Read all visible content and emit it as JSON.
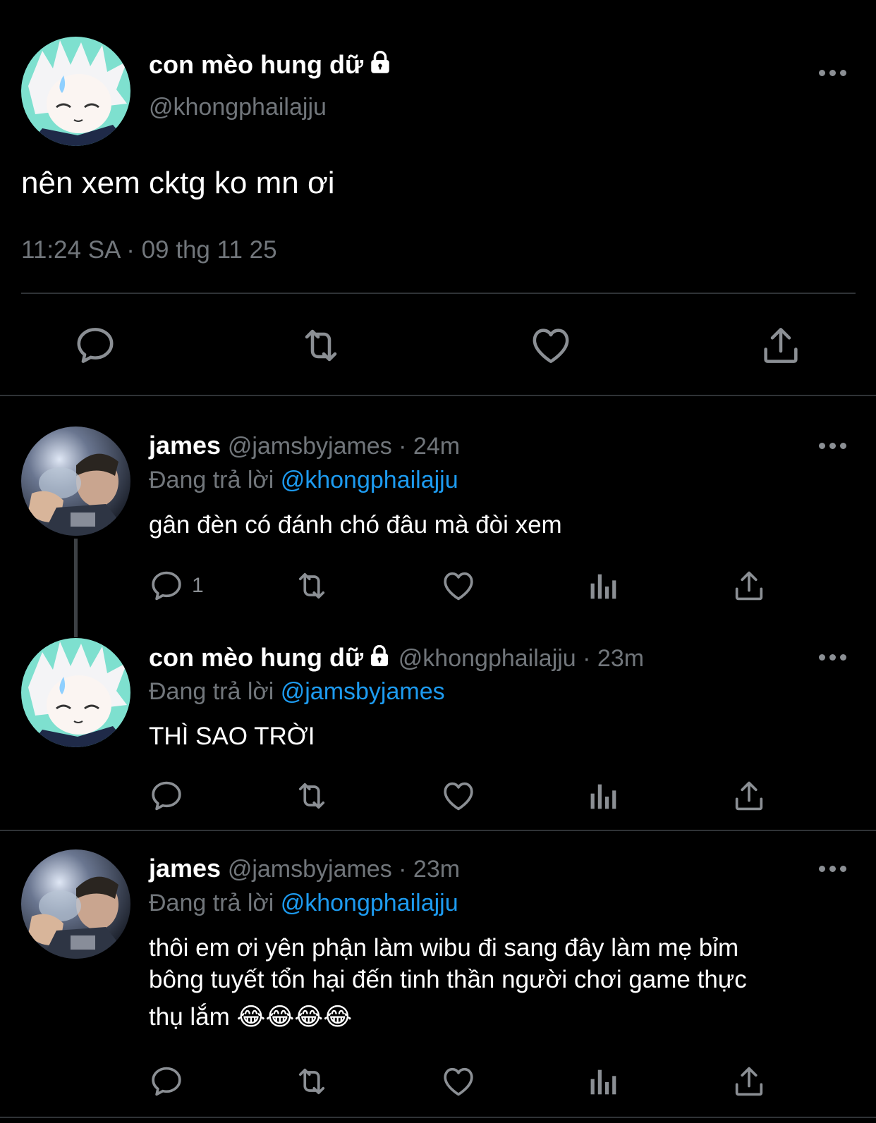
{
  "main_tweet": {
    "display_name": "con mèo hung dữ",
    "handle": "@khongphailajju",
    "text": "nên xem cktg ko mn ơi",
    "timestamp": "11:24 SA · 09 thg 11 25",
    "icons": [
      "reply-icon",
      "retweet-icon",
      "like-icon",
      "share-icon"
    ]
  },
  "replies": [
    {
      "display_name": "james",
      "meta": "@jamsbyjames · 24m",
      "replying_prefix": "Đang trả lời",
      "replying_to": "@khongphailajju",
      "text": "gân đèn có đánh chó đâu mà đòi xem",
      "reply_count": "1"
    },
    {
      "display_name": "con mèo hung dữ",
      "meta": "@khongphailajju · 23m",
      "replying_prefix": "Đang trả lời",
      "replying_to": "@jamsbyjames",
      "text": "THÌ SAO TRỜI"
    },
    {
      "display_name": "james",
      "meta": "@jamsbyjames · 23m",
      "replying_prefix": "Đang trả lời",
      "replying_to": "@khongphailajju",
      "text_line1": "thôi em ơi yên phận làm wibu đi sang đây làm mẹ bỉm",
      "text_line2": "bông tuyết tổn hại đến tinh thần người chơi game thực",
      "text_line3": "thụ lắm",
      "emoji": "😂😂😂😂"
    }
  ],
  "colors": {
    "background": "#000000",
    "muted": "#71767b",
    "link": "#1d9bf0",
    "divider": "#2f3336"
  }
}
